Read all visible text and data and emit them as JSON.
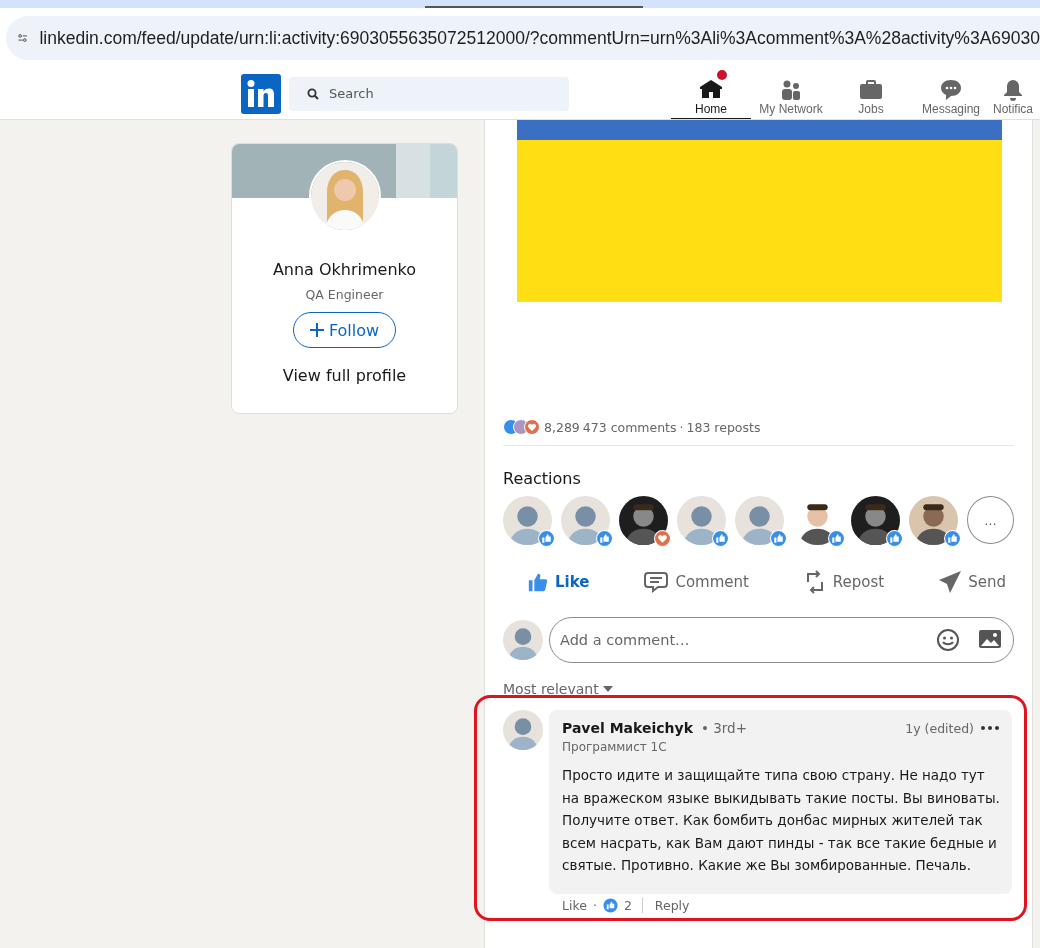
{
  "browser": {
    "url": "linkedin.com/feed/update/urn:li:activity:6903055635072512000/?commentUrn=urn%3Ali%3Acomment%3A%28activity%3A69030"
  },
  "nav": {
    "search": {
      "placeholder": "Search"
    },
    "items": [
      {
        "label": "Home",
        "selected": true,
        "badge": true
      },
      {
        "label": "My Network",
        "selected": false,
        "badge": false
      },
      {
        "label": "Jobs",
        "selected": false,
        "badge": false
      },
      {
        "label": "Messaging",
        "selected": false,
        "badge": false
      },
      {
        "label": "Notifica",
        "selected": false,
        "badge": false
      }
    ]
  },
  "profile": {
    "name": "Anna Okhrimenko",
    "headline": "QA Engineer",
    "follow": "Follow",
    "view": "View full profile"
  },
  "post": {
    "image": {
      "kind": "flag"
    },
    "counts": {
      "reactions": "8,289",
      "comments": "473 comments",
      "separator": "·",
      "reposts": "183 reposts"
    },
    "reactions_title": "Reactions",
    "reactors": [
      {
        "kind": "default",
        "love": false
      },
      {
        "kind": "default",
        "love": false
      },
      {
        "kind": "picture",
        "love": true
      },
      {
        "kind": "default",
        "love": false
      },
      {
        "kind": "default",
        "love": false
      },
      {
        "kind": "picture",
        "love": false
      },
      {
        "kind": "picture",
        "love": false
      },
      {
        "kind": "picture",
        "love": false
      }
    ],
    "more": "…",
    "actions": [
      {
        "label": "Like",
        "selected": true
      },
      {
        "label": "Comment",
        "selected": false
      },
      {
        "label": "Repost",
        "selected": false
      },
      {
        "label": "Send",
        "selected": false
      }
    ],
    "comment_box": {
      "placeholder": "Add a comment…"
    },
    "sort": "Most relevant",
    "comments": [
      {
        "author": "Pavel Makeichyk",
        "degree": "• 3rd+",
        "headline": "Программист 1С",
        "time": "1y (edited)",
        "text": "Просто идите и защищайте типа свою страну. Не надо тут на вражеском языке выкидывать такие посты. Вы виноваты. Получите ответ. Как бомбить донбас мирных жителей так всем насрать, как Вам дают пинды - так все такие бедные и святые. Противно. Какие же Вы зомбированные. Печаль.",
        "like": "Like",
        "dot": "·",
        "likes": "2",
        "reply": "Reply",
        "highlighted": true
      }
    ]
  }
}
